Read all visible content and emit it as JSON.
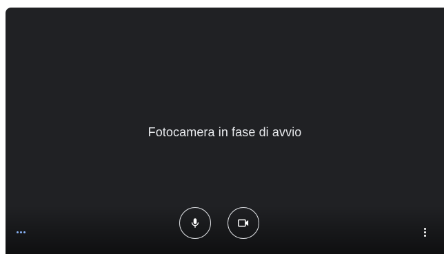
{
  "video_preview": {
    "status_message": "Fotocamera in fase di avvio"
  },
  "controls": {
    "microphone_icon": "mic-icon",
    "camera_icon": "videocam-icon",
    "more_options_icon": "more-vert-icon",
    "indicator_icon": "more-horiz-icon"
  },
  "colors": {
    "background": "#202124",
    "text": "#e8eaed",
    "button_border": "#dadce0",
    "indicator_dots": "#8ab4f8"
  }
}
